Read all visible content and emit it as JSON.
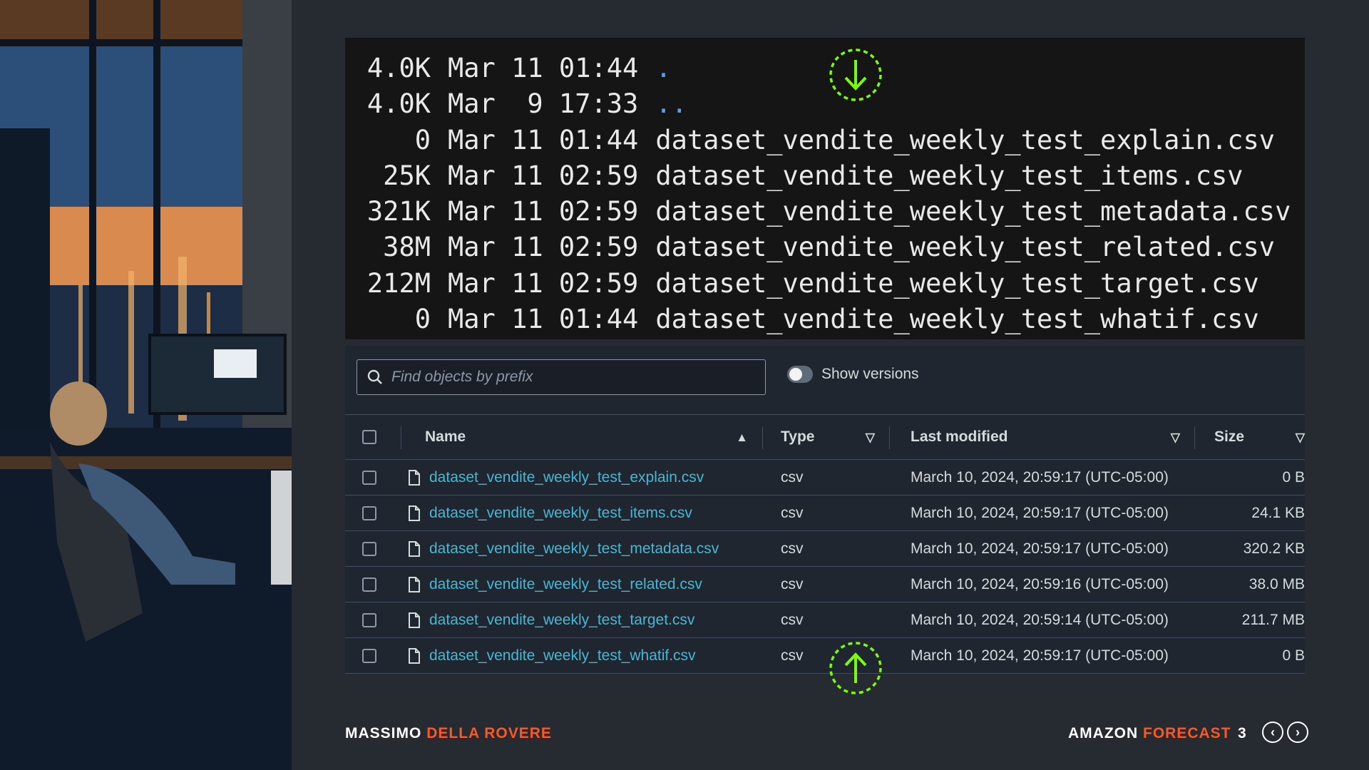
{
  "terminal": {
    "lines": [
      {
        "size": "4.0K",
        "date": "Mar 11 01:44",
        "name": "."
      },
      {
        "size": "4.0K",
        "date": "Mar  9 17:33",
        "name": ".."
      },
      {
        "size": "0",
        "date": "Mar 11 01:44",
        "name": "dataset_vendite_weekly_test_explain.csv"
      },
      {
        "size": "25K",
        "date": "Mar 11 02:59",
        "name": "dataset_vendite_weekly_test_items.csv"
      },
      {
        "size": "321K",
        "date": "Mar 11 02:59",
        "name": "dataset_vendite_weekly_test_metadata.csv"
      },
      {
        "size": "38M",
        "date": "Mar 11 02:59",
        "name": "dataset_vendite_weekly_test_related.csv"
      },
      {
        "size": "212M",
        "date": "Mar 11 02:59",
        "name": "dataset_vendite_weekly_test_target.csv"
      },
      {
        "size": "0",
        "date": "Mar 11 01:44",
        "name": "dataset_vendite_weekly_test_whatif.csv"
      }
    ]
  },
  "s3": {
    "search_placeholder": "Find objects by prefix",
    "show_versions_label": "Show versions",
    "columns": {
      "name": "Name",
      "type": "Type",
      "last_modified": "Last modified",
      "size": "Size"
    },
    "rows": [
      {
        "name": "dataset_vendite_weekly_test_explain.csv",
        "type": "csv",
        "modified": "March 10, 2024, 20:59:17 (UTC-05:00)",
        "size": "0 B"
      },
      {
        "name": "dataset_vendite_weekly_test_items.csv",
        "type": "csv",
        "modified": "March 10, 2024, 20:59:17 (UTC-05:00)",
        "size": "24.1 KB"
      },
      {
        "name": "dataset_vendite_weekly_test_metadata.csv",
        "type": "csv",
        "modified": "March 10, 2024, 20:59:17 (UTC-05:00)",
        "size": "320.2 KB"
      },
      {
        "name": "dataset_vendite_weekly_test_related.csv",
        "type": "csv",
        "modified": "March 10, 2024, 20:59:16 (UTC-05:00)",
        "size": "38.0 MB"
      },
      {
        "name": "dataset_vendite_weekly_test_target.csv",
        "type": "csv",
        "modified": "March 10, 2024, 20:59:14 (UTC-05:00)",
        "size": "211.7 MB"
      },
      {
        "name": "dataset_vendite_weekly_test_whatif.csv",
        "type": "csv",
        "modified": "March 10, 2024, 20:59:17 (UTC-05:00)",
        "size": "0 B"
      }
    ]
  },
  "footer": {
    "author_first": "MASSIMO",
    "author_last": "DELLA ROVERE",
    "topic_first": "AMAZON",
    "topic_last": "FORECAST",
    "page": "3"
  },
  "colors": {
    "accent": "#ff5722",
    "link": "#44b9d6",
    "arrow": "#7cfc00"
  },
  "icons": [
    "arrow-down-icon",
    "arrow-up-icon",
    "search-icon",
    "file-icon",
    "sort-up-icon",
    "sort-down-icon",
    "chevron-left-icon",
    "chevron-right-icon"
  ]
}
